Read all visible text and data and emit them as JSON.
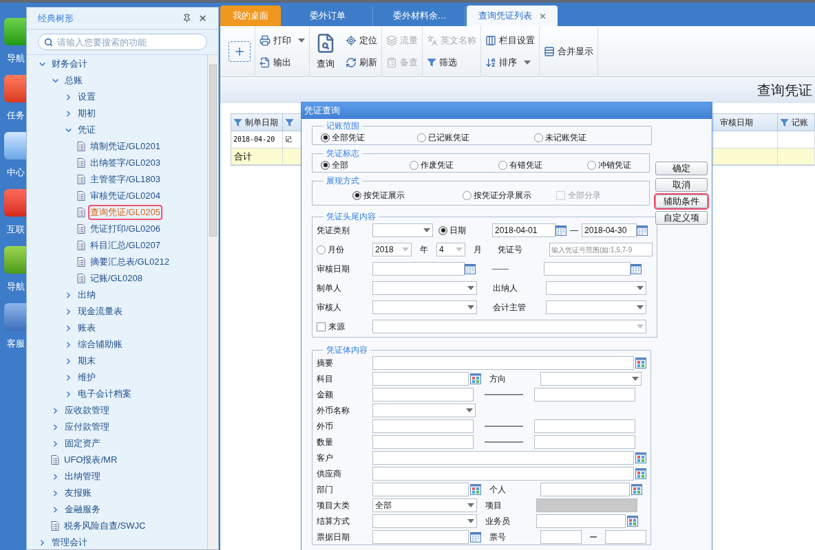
{
  "dock": [
    {
      "label": "导航"
    },
    {
      "label": "任务"
    },
    {
      "label": "中心"
    },
    {
      "label": "互联"
    },
    {
      "label": "导航"
    },
    {
      "label": "客服"
    }
  ],
  "tree_panel": {
    "title": "经典树形",
    "search": {
      "placeholder": "请输入您要搜索的功能"
    },
    "items": [
      {
        "label": "财务会计",
        "kind": "folder",
        "expanded": true,
        "selected": false,
        "highlighted": false,
        "children": [
          {
            "label": "总账",
            "kind": "folder",
            "expanded": true,
            "selected": false,
            "highlighted": false,
            "children": [
              {
                "label": "设置",
                "kind": "folder",
                "expanded": false,
                "selected": false,
                "highlighted": false
              },
              {
                "label": "期初",
                "kind": "folder",
                "expanded": false,
                "selected": false,
                "highlighted": false
              },
              {
                "label": "凭证",
                "kind": "folder",
                "expanded": true,
                "selected": false,
                "highlighted": false,
                "children": [
                  {
                    "label": "填制凭证/GL0201",
                    "kind": "page",
                    "selected": false,
                    "highlighted": false
                  },
                  {
                    "label": "出纳签字/GL0203",
                    "kind": "page",
                    "selected": false,
                    "highlighted": false
                  },
                  {
                    "label": "主管签字/GL1803",
                    "kind": "page",
                    "selected": false,
                    "highlighted": false
                  },
                  {
                    "label": "审核凭证/GL0204",
                    "kind": "page",
                    "selected": false,
                    "highlighted": false
                  },
                  {
                    "label": "查询凭证/GL0205",
                    "kind": "page",
                    "selected": true,
                    "highlighted": true
                  },
                  {
                    "label": "凭证打印/GL0206",
                    "kind": "page",
                    "selected": false,
                    "highlighted": false
                  },
                  {
                    "label": "科目汇总/GL0207",
                    "kind": "page",
                    "selected": false,
                    "highlighted": false
                  },
                  {
                    "label": "摘要汇总表/GL0212",
                    "kind": "page",
                    "selected": false,
                    "highlighted": false
                  },
                  {
                    "label": "记账/GL0208",
                    "kind": "page",
                    "selected": false,
                    "highlighted": false
                  }
                ]
              },
              {
                "label": "出纳",
                "kind": "folder",
                "expanded": false,
                "selected": false,
                "highlighted": false
              },
              {
                "label": "现金流量表",
                "kind": "folder",
                "expanded": false,
                "selected": false,
                "highlighted": false
              },
              {
                "label": "账表",
                "kind": "folder",
                "expanded": false,
                "selected": false,
                "highlighted": false
              },
              {
                "label": "综合辅助账",
                "kind": "folder",
                "expanded": false,
                "selected": false,
                "highlighted": false
              },
              {
                "label": "期末",
                "kind": "folder",
                "expanded": false,
                "selected": false,
                "highlighted": false
              },
              {
                "label": "维护",
                "kind": "folder",
                "expanded": false,
                "selected": false,
                "highlighted": false
              },
              {
                "label": "电子会计档案",
                "kind": "folder",
                "expanded": false,
                "selected": false,
                "highlighted": false
              }
            ]
          },
          {
            "label": "应收款管理",
            "kind": "folder",
            "expanded": false,
            "selected": false,
            "highlighted": false
          },
          {
            "label": "应付款管理",
            "kind": "folder",
            "expanded": false,
            "selected": false,
            "highlighted": false
          },
          {
            "label": "固定资产",
            "kind": "folder",
            "expanded": false,
            "selected": false,
            "highlighted": false
          },
          {
            "label": "UFO报表/MR",
            "kind": "page",
            "selected": false,
            "highlighted": false
          },
          {
            "label": "出纳管理",
            "kind": "folder",
            "expanded": false,
            "selected": false,
            "highlighted": false
          },
          {
            "label": "友报账",
            "kind": "folder",
            "expanded": false,
            "selected": false,
            "highlighted": false
          },
          {
            "label": "金融服务",
            "kind": "folder",
            "expanded": false,
            "selected": false,
            "highlighted": false
          },
          {
            "label": "税务风险自查/SWJC",
            "kind": "page",
            "selected": false,
            "highlighted": false
          }
        ]
      },
      {
        "label": "管理会计",
        "kind": "folder",
        "expanded": false,
        "selected": false,
        "highlighted": false
      }
    ]
  },
  "tabs": [
    {
      "label": "我的桌面",
      "kind": "home",
      "selected": false
    },
    {
      "label": "委外订单",
      "kind": "page",
      "selected": false
    },
    {
      "label": "委外材料余…",
      "kind": "page",
      "selected": false
    },
    {
      "label": "查询凭证列表",
      "kind": "page",
      "selected": true,
      "closable": true
    }
  ],
  "toolbar": [
    {
      "items": [
        {
          "kind": "add"
        }
      ]
    },
    {
      "items": [
        {
          "kind": "small",
          "label": "打印",
          "dropdown": true,
          "disabled": false
        },
        {
          "kind": "small",
          "label": "输出",
          "disabled": false
        }
      ]
    },
    {
      "items": [
        {
          "kind": "large",
          "label": "查询",
          "disabled": false
        },
        {
          "kind": "small",
          "label": "定位",
          "disabled": false
        },
        {
          "kind": "small",
          "label": "刷新",
          "disabled": false
        }
      ]
    },
    {
      "items": [
        {
          "kind": "small",
          "label": "流量",
          "disabled": true
        },
        {
          "kind": "small",
          "label": "备查",
          "disabled": true
        }
      ]
    },
    {
      "items": [
        {
          "kind": "small",
          "label": "英文名称",
          "disabled": true
        },
        {
          "kind": "small",
          "label": "筛选",
          "disabled": false
        }
      ]
    },
    {
      "items": [
        {
          "kind": "small",
          "label": "栏目设置",
          "disabled": false
        },
        {
          "kind": "small",
          "label": "排序",
          "dropdown": true,
          "disabled": false
        }
      ]
    },
    {
      "items": [
        {
          "kind": "small",
          "label": "合并显示",
          "disabled": false
        }
      ]
    }
  ],
  "page_title": "查询凭证",
  "table": {
    "columns": [
      {
        "label": "制单日期",
        "filter": true
      },
      {
        "filter": true
      },
      {
        "label": "审核日期",
        "filter": false
      },
      {
        "label": "记账",
        "filter": true
      }
    ],
    "rows": [
      [
        "2018-04-20",
        "记"
      ]
    ],
    "total_row": {
      "label": "合计"
    }
  },
  "dialog": {
    "title": "凭证查询",
    "groups": [
      {
        "legend": "记账范围",
        "options": [
          {
            "label": "全部凭证",
            "selected": true
          },
          {
            "label": "已记账凭证",
            "selected": false
          },
          {
            "label": "未记账凭证",
            "selected": false
          }
        ]
      },
      {
        "legend": "凭证标志",
        "options": [
          {
            "label": "全部",
            "selected": true
          },
          {
            "label": "作废凭证",
            "selected": false
          },
          {
            "label": "有错凭证",
            "selected": false
          },
          {
            "label": "冲销凭证",
            "selected": false
          }
        ]
      },
      {
        "legend": "展现方式",
        "options": [
          {
            "label": "按凭证展示",
            "selected": true
          },
          {
            "label": "按凭证分录展示",
            "selected": false
          }
        ],
        "checkbox": {
          "label": "全部分录",
          "checked": false,
          "disabled": true
        }
      }
    ],
    "header": {
      "legend": "凭证头尾内容",
      "voucher_type": {
        "label": "凭证类别"
      },
      "date": {
        "label": "日期",
        "selected": true,
        "from": "2018-04-01",
        "to": "2018-04-30"
      },
      "month": {
        "label": "月份",
        "selected": false,
        "year": "2018",
        "year_unit": "年",
        "month": "4",
        "month_unit": "月"
      },
      "voucher_no": {
        "label": "凭证号",
        "placeholder": "输入凭证号范围(如:1,5,7-9"
      },
      "audit_date": {
        "label": "审核日期"
      },
      "maker": {
        "label": "制单人"
      },
      "cashier": {
        "label": "出纳人"
      },
      "auditor": {
        "label": "审核人"
      },
      "supervisor": {
        "label": "会计主管"
      },
      "source": {
        "label": "来源",
        "checked": false
      }
    },
    "body": {
      "legend": "凭证体内容",
      "rows": [
        {
          "label": "摘要",
          "field": {
            "kind": "ref"
          }
        },
        {
          "label": "科目",
          "field": {
            "kind": "ref"
          },
          "pair": {
            "label": "方向",
            "field": {
              "kind": "dropdown"
            }
          }
        },
        {
          "label": "金额",
          "field": {
            "kind": "input"
          },
          "dash": true,
          "pair": {
            "field": {
              "kind": "input"
            }
          }
        },
        {
          "label": "外币名称",
          "field": {
            "kind": "dropdown"
          }
        },
        {
          "label": "外币",
          "field": {
            "kind": "input"
          },
          "dash": true,
          "pair": {
            "field": {
              "kind": "input"
            }
          }
        },
        {
          "label": "数量",
          "field": {
            "kind": "input"
          },
          "dash": true,
          "pair": {
            "field": {
              "kind": "input"
            }
          }
        },
        {
          "label": "客户",
          "field": {
            "kind": "ref"
          }
        },
        {
          "label": "供应商",
          "field": {
            "kind": "ref"
          }
        },
        {
          "label": "部门",
          "field": {
            "kind": "ref"
          },
          "pair": {
            "label": "个人",
            "field": {
              "kind": "ref"
            }
          }
        },
        {
          "label": "项目大类",
          "field": {
            "kind": "dropdown",
            "value": "全部"
          },
          "pair": {
            "label": "项目",
            "field": {
              "kind": "disabled"
            }
          }
        },
        {
          "label": "结算方式",
          "field": {
            "kind": "dropdown"
          },
          "pair": {
            "label": "业务员",
            "field": {
              "kind": "ref"
            }
          }
        },
        {
          "label": "票据日期",
          "field": {
            "kind": "date"
          },
          "pair": {
            "label": "票号",
            "field": {
              "kind": "range"
            }
          }
        }
      ]
    },
    "buttons": [
      {
        "label": "确定",
        "highlighted": false
      },
      {
        "label": "取消",
        "highlighted": false
      },
      {
        "label": "辅助条件",
        "highlighted": true
      },
      {
        "label": "自定义项",
        "highlighted": false
      }
    ]
  }
}
